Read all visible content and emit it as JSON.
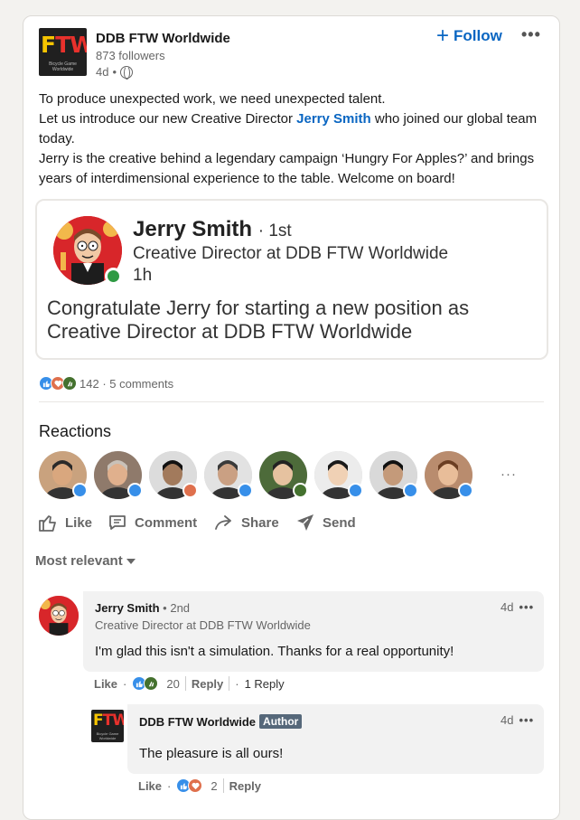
{
  "post": {
    "org_name": "DDB FTW Worldwide",
    "followers": "873 followers",
    "age": "4d",
    "bullet": "•",
    "follow_label": "Follow",
    "follow_plus": "+",
    "menu_dots": "•••",
    "logo_text": {
      "f": "F",
      "t": "T",
      "w": "W",
      "sub": "Bicycle Game Worldwide"
    },
    "text_lines": [
      "To produce unexpected work, we need unexpected talent.",
      "Let us introduce our new Creative Director",
      "who joined our global team today.",
      "Jerry is the creative behind a legendary campaign ‘Hungry For Apples?’ and brings years of interdimensional experience to the table. Welcome on board!"
    ],
    "mention": "Jerry Smith"
  },
  "share_card": {
    "name": "Jerry Smith",
    "degree": "· 1st",
    "title": "Creative Director at DDB FTW Worldwide",
    "time": "1h",
    "message": "Congratulate Jerry for starting a new position as Creative Director at DDB FTW Worldwide"
  },
  "social": {
    "count": "142",
    "comments": "· 5 comments",
    "reactions_title": "Reactions",
    "more": "···",
    "reactions": [
      "like",
      "love",
      "celebrate"
    ],
    "reactors": [
      {
        "badge": "like"
      },
      {
        "badge": "like"
      },
      {
        "badge": "love"
      },
      {
        "badge": "like"
      },
      {
        "badge": "celebrate"
      },
      {
        "badge": "like"
      },
      {
        "badge": "like"
      },
      {
        "badge": "like"
      }
    ]
  },
  "actions": {
    "like": "Like",
    "comment": "Comment",
    "share": "Share",
    "send": "Send"
  },
  "sort_label": "Most relevant",
  "comments": [
    {
      "name": "Jerry Smith",
      "degree": "• 2nd",
      "title": "Creative Director at DDB FTW Worldwide",
      "time": "4d",
      "text": "I'm glad this isn't a simulation. Thanks for a real opportunity!",
      "like": "Like",
      "dot": "·",
      "count": "20",
      "reply": "Reply",
      "replies": "1 Reply",
      "replies_dot": "·"
    },
    {
      "name": "DDB FTW Worldwide",
      "badge": "Author",
      "time": "4d",
      "text": "The pleasure is all ours!",
      "like": "Like",
      "dot": "·",
      "count": "2",
      "reply": "Reply"
    }
  ],
  "colors": {
    "link": "#0a66c2",
    "like": "#378fe9",
    "love": "#df704d",
    "celebrate": "#44712e",
    "online": "#2e9a43"
  }
}
